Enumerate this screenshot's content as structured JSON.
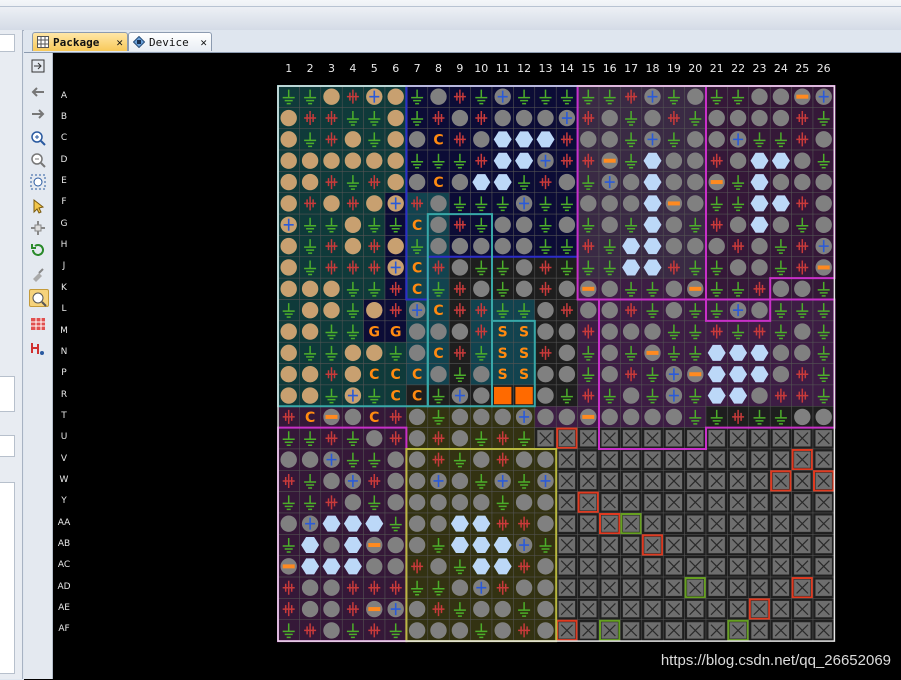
{
  "tabs": [
    {
      "label": "Package",
      "active": true,
      "icon": "package-grid-icon",
      "close": "✕"
    },
    {
      "label": "Device",
      "active": false,
      "icon": "device-chip-icon",
      "close": "✕"
    }
  ],
  "toolbar": {
    "buttons": [
      "auto-fit-icon",
      "back-arrow-icon",
      "forward-arrow-icon",
      "zoom-in-icon",
      "zoom-out-icon",
      "zoom-fit-icon",
      "select-icon",
      "move-icon",
      "rotate-icon",
      "pin-icon",
      "highlight-icon",
      "grid-view-icon",
      "route-icon"
    ],
    "active_button": "highlight-icon"
  },
  "package": {
    "columns": [
      "1",
      "2",
      "3",
      "4",
      "5",
      "6",
      "7",
      "8",
      "9",
      "10",
      "11",
      "12",
      "13",
      "14",
      "15",
      "16",
      "17",
      "18",
      "19",
      "20",
      "21",
      "22",
      "23",
      "24",
      "25",
      "26"
    ],
    "rows": [
      "A",
      "B",
      "C",
      "D",
      "E",
      "F",
      "G",
      "H",
      "J",
      "K",
      "L",
      "M",
      "N",
      "P",
      "R",
      "T",
      "U",
      "V",
      "W",
      "Y",
      "AA",
      "AB",
      "AC",
      "AD",
      "AE",
      "AF"
    ],
    "special_pins": [
      {
        "row": "C",
        "col": "8",
        "text": "C"
      },
      {
        "row": "E",
        "col": "8",
        "text": "C"
      },
      {
        "row": "G",
        "col": "7",
        "text": "C"
      },
      {
        "row": "J",
        "col": "7",
        "text": "C"
      },
      {
        "row": "K",
        "col": "7",
        "text": "C"
      },
      {
        "row": "L",
        "col": "8",
        "text": "C"
      },
      {
        "row": "M",
        "col": "5",
        "text": "G"
      },
      {
        "row": "M",
        "col": "6",
        "text": "G"
      },
      {
        "row": "N",
        "col": "8",
        "text": "C"
      },
      {
        "row": "P",
        "col": "5",
        "text": "C"
      },
      {
        "row": "P",
        "col": "6",
        "text": "C"
      },
      {
        "row": "P",
        "col": "7",
        "text": "C"
      },
      {
        "row": "R",
        "col": "6",
        "text": "C"
      },
      {
        "row": "R",
        "col": "7",
        "text": "C"
      },
      {
        "row": "T",
        "col": "2",
        "text": "C"
      },
      {
        "row": "T",
        "col": "5",
        "text": "C"
      },
      {
        "row": "M",
        "col": "11",
        "text": "S"
      },
      {
        "row": "M",
        "col": "12",
        "text": "S"
      },
      {
        "row": "N",
        "col": "11",
        "text": "S"
      },
      {
        "row": "N",
        "col": "12",
        "text": "S"
      },
      {
        "row": "P",
        "col": "11",
        "text": "S"
      },
      {
        "row": "P",
        "col": "12",
        "text": "S"
      }
    ]
  },
  "colors": {
    "background": "#000000",
    "pin_gray": "#808080",
    "pin_tan": "#c8a070",
    "hex_blue": "#bcd8f8",
    "gnd_green": "#3c8a2a",
    "pwr_red": "#c83c3c",
    "text_orange": "#ff8a10",
    "bank_teal": "#38a8a8",
    "bank_blue": "#2c2cc8",
    "bank_magenta": "#c830c8",
    "bank_yellow": "#b8b840"
  },
  "watermark": "https://blog.csdn.net/qq_26652069"
}
